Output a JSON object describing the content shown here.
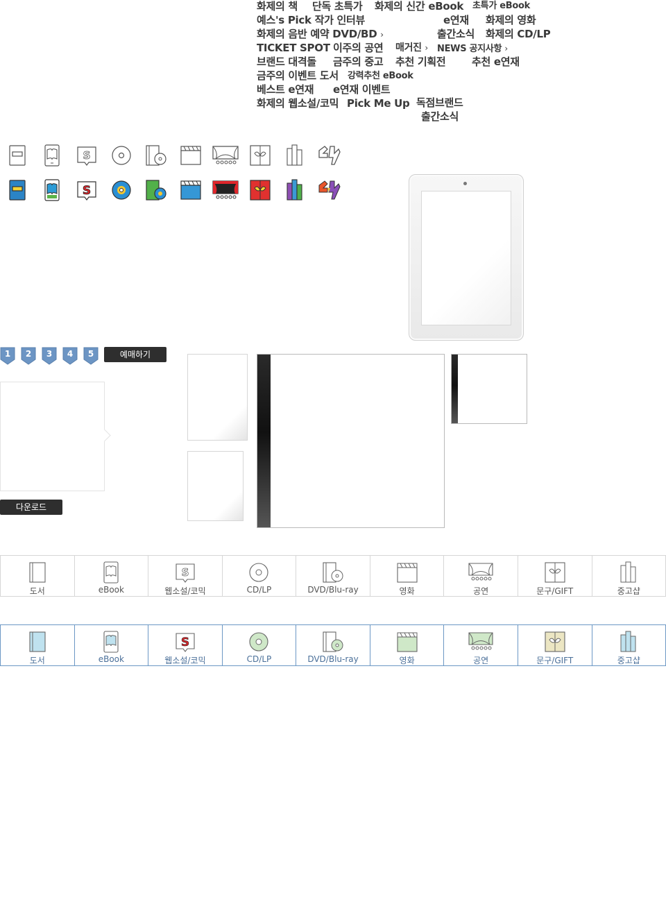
{
  "sprite_labels": [
    "화제의 책",
    "단독 초특가",
    "화제의 신간 eBook",
    "초특가 eBook",
    "예스's Pick 작가 인터뷰",
    "e연재",
    "화제의 영화",
    "화제의 음반 예약 DVD/BD",
    "출간소식",
    "화제의 CD/LP",
    "TICKET SPOT",
    "이주의 공연",
    "매거진",
    "NEWS 공지사항",
    "브랜드 대격돌",
    "금주의 중고",
    "추천 기획전",
    "추천 e연재",
    "금주의 이벤트 도서",
    "강력추천 eBook",
    "베스트 e연재",
    "e연재 이벤트",
    "화제의 웹소설/코믹",
    "Pick Me Up",
    "독점브랜드",
    "출간소식"
  ],
  "chevron": "›",
  "icon_rows": {
    "outline": [
      "book-icon",
      "ebook-icon",
      "webnovel-icon",
      "cd-icon",
      "dvd-icon",
      "movie-icon",
      "performance-icon",
      "gift-icon",
      "used-shop-icon",
      "yes24-logo-icon"
    ],
    "color": [
      "book-icon",
      "ebook-icon",
      "webnovel-icon",
      "cd-icon",
      "dvd-icon",
      "movie-icon",
      "performance-icon",
      "gift-icon",
      "used-shop-icon",
      "yes24-logo-icon"
    ]
  },
  "rank_badges": [
    "1",
    "2",
    "3",
    "4",
    "5"
  ],
  "buttons": {
    "reserve": "예매하기",
    "download": "다운로드"
  },
  "categories": [
    {
      "label": "도서",
      "icon": "book-icon",
      "color": "#bfe2ef"
    },
    {
      "label": "eBook",
      "icon": "ebook-icon",
      "color": "#bfe2ef"
    },
    {
      "label": "웹소설/코믹",
      "icon": "webnovel-icon",
      "color": "#d6262b"
    },
    {
      "label": "CD/LP",
      "icon": "cd-icon",
      "color": "#cfe8c8"
    },
    {
      "label": "DVD/Blu-ray",
      "icon": "dvd-icon",
      "color": "#cfe8c8"
    },
    {
      "label": "영화",
      "icon": "movie-icon",
      "color": "#cfe8c8"
    },
    {
      "label": "공연",
      "icon": "performance-icon",
      "color": "#cfe8c8"
    },
    {
      "label": "문구/GIFT",
      "icon": "gift-icon",
      "color": "#ece6c3"
    },
    {
      "label": "중고샵",
      "icon": "used-shop-icon",
      "color": "#bfe2ef"
    }
  ],
  "colors": {
    "accent_blue": "#4f86c2",
    "badge_blue": "#6c95c4",
    "dark": "#2e2e2e",
    "tab_border_blue": "#6b97c4",
    "tab_border_gray": "#d6d6d6"
  }
}
